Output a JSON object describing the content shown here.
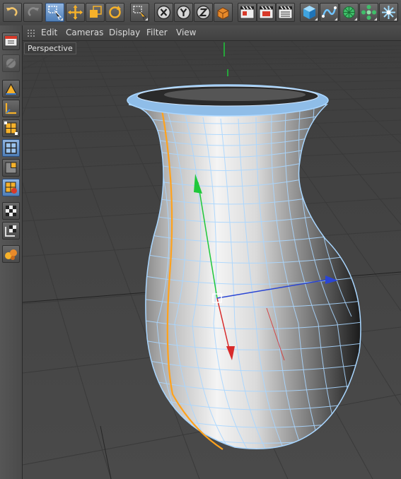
{
  "menu": {
    "items": [
      "Edit",
      "Cameras",
      "Display",
      "Filter",
      "View"
    ]
  },
  "viewport": {
    "label": "Perspective"
  },
  "toolbar": {
    "buttons": [
      "undo-icon",
      "redo-icon",
      "live-selection-icon",
      "move-icon",
      "scale-icon",
      "rotate-icon",
      "last-tool-icon",
      "x-axis-icon",
      "y-axis-icon",
      "z-axis-icon",
      "coordinate-system-icon",
      "render-view-icon",
      "render-picture-viewer-icon",
      "render-settings-icon",
      "cube-primitive-icon",
      "spline-pen-icon",
      "subdivision-surface-icon",
      "array-icon",
      "deformer-icon"
    ]
  },
  "left_palette": {
    "buttons": [
      "model-mode-icon",
      "object-axis-mode-icon",
      "texture-mode-icon",
      "workplane-mode-icon",
      "points-mode-icon",
      "edges-mode-icon",
      "polygons-mode-icon",
      "uv-mode-icon",
      "enable-axis-icon",
      "snap-grid-icon",
      "snap-settings-icon",
      "sculpt-icon"
    ]
  },
  "colors": {
    "selection": "#5f92d1",
    "wire": "#a9d6ff",
    "spline": "#ffa21c",
    "axis_x": "#d82a2a",
    "axis_y": "#1fc83a",
    "axis_z": "#2a45d4"
  }
}
